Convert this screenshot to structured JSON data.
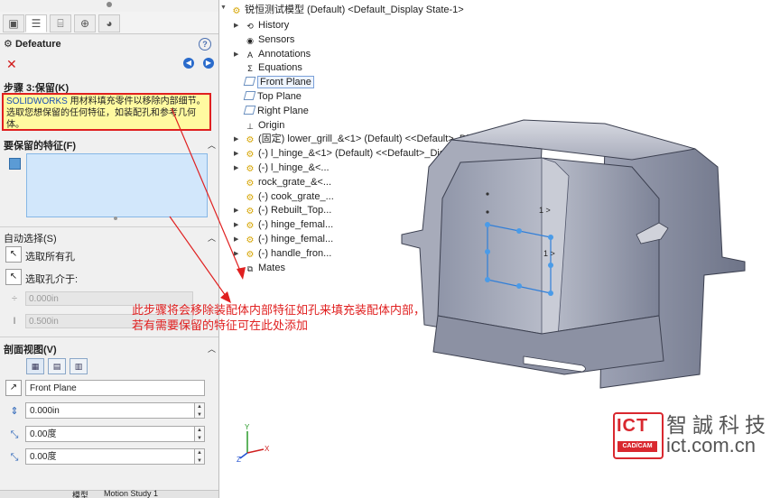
{
  "property_manager": {
    "title": "Defeature",
    "help_glyph": "?",
    "step_header": "步骤 3:保留",
    "step_shortcut": "(K)",
    "message_brand": "SOLIDWORKS",
    "message_text": " 用材料填充零件以移除内部细节。选取您想保留的任何特征，如装配孔和参考几何体。",
    "keep_header": "要保留的特征",
    "keep_shortcut": "(F)",
    "auto_header": "自动选择",
    "auto_shortcut": "(S)",
    "select_all_holes": "选取所有孔",
    "select_holes_between": "选取孔介于:",
    "min_value": "0.000in",
    "max_value": "0.500in",
    "section_header": "剖面视图",
    "section_shortcut": "(V)",
    "plane_value": "Front Plane",
    "offset_value": "0.000in",
    "angle1_value": "0.00度",
    "angle2_value": "0.00度",
    "bottom_tab1": "模型",
    "bottom_tab2": "Motion Study 1"
  },
  "tree": {
    "root": "锐恒测试模型 (Default) <Default_Display State-1>",
    "items": [
      {
        "label": "History",
        "icon": "history-icon"
      },
      {
        "label": "Sensors",
        "icon": "sensors-icon"
      },
      {
        "label": "Annotations",
        "icon": "annotations-icon"
      },
      {
        "label": "Equations",
        "icon": "equations-icon"
      },
      {
        "label": "Front Plane",
        "icon": "plane-icon"
      },
      {
        "label": "Top Plane",
        "icon": "plane-icon"
      },
      {
        "label": "Right Plane",
        "icon": "plane-icon"
      },
      {
        "label": "Origin",
        "icon": "origin-icon"
      },
      {
        "label": "(固定) lower_grill_&<1> (Default) <<Default>_Display State 1>",
        "icon": "component-icon"
      },
      {
        "label": "(-) l_hinge_&<1> (Default) <<Default>_Display State 1>",
        "icon": "component-icon"
      },
      {
        "label": "(-) l_hinge_&<...",
        "icon": "component-icon"
      },
      {
        "label": "rock_grate_&<...",
        "icon": "component-icon"
      },
      {
        "label": "(-) cook_grate_...",
        "icon": "component-icon"
      },
      {
        "label": "(-) Rebuilt_Top...",
        "icon": "component-icon"
      },
      {
        "label": "(-) hinge_femal...",
        "icon": "component-icon"
      },
      {
        "label": "(-) hinge_femal...",
        "icon": "component-icon"
      },
      {
        "label": "(-) handle_fron...",
        "icon": "component-icon"
      },
      {
        "label": "Mates",
        "icon": "mates-icon"
      }
    ]
  },
  "annotation": {
    "line1": "此步骤将会移除装配体内部特征如孔来填充装配体内部，",
    "line2": "若有需要保留的特征可在此处添加"
  },
  "viewport": {
    "dim_label_1": "1 >",
    "dim_label_2": "1 >",
    "triad_y": "Y",
    "triad_x": "X",
    "triad_z": "Z"
  },
  "logo": {
    "ict": "ICT",
    "sub": "CAD/CAM",
    "cn": "智誠科技",
    "url": "ict.com.cn"
  },
  "colors": {
    "accent_red": "#e02020",
    "selection_blue": "#d2e7fb",
    "model_grey": "#9fa4b5"
  }
}
